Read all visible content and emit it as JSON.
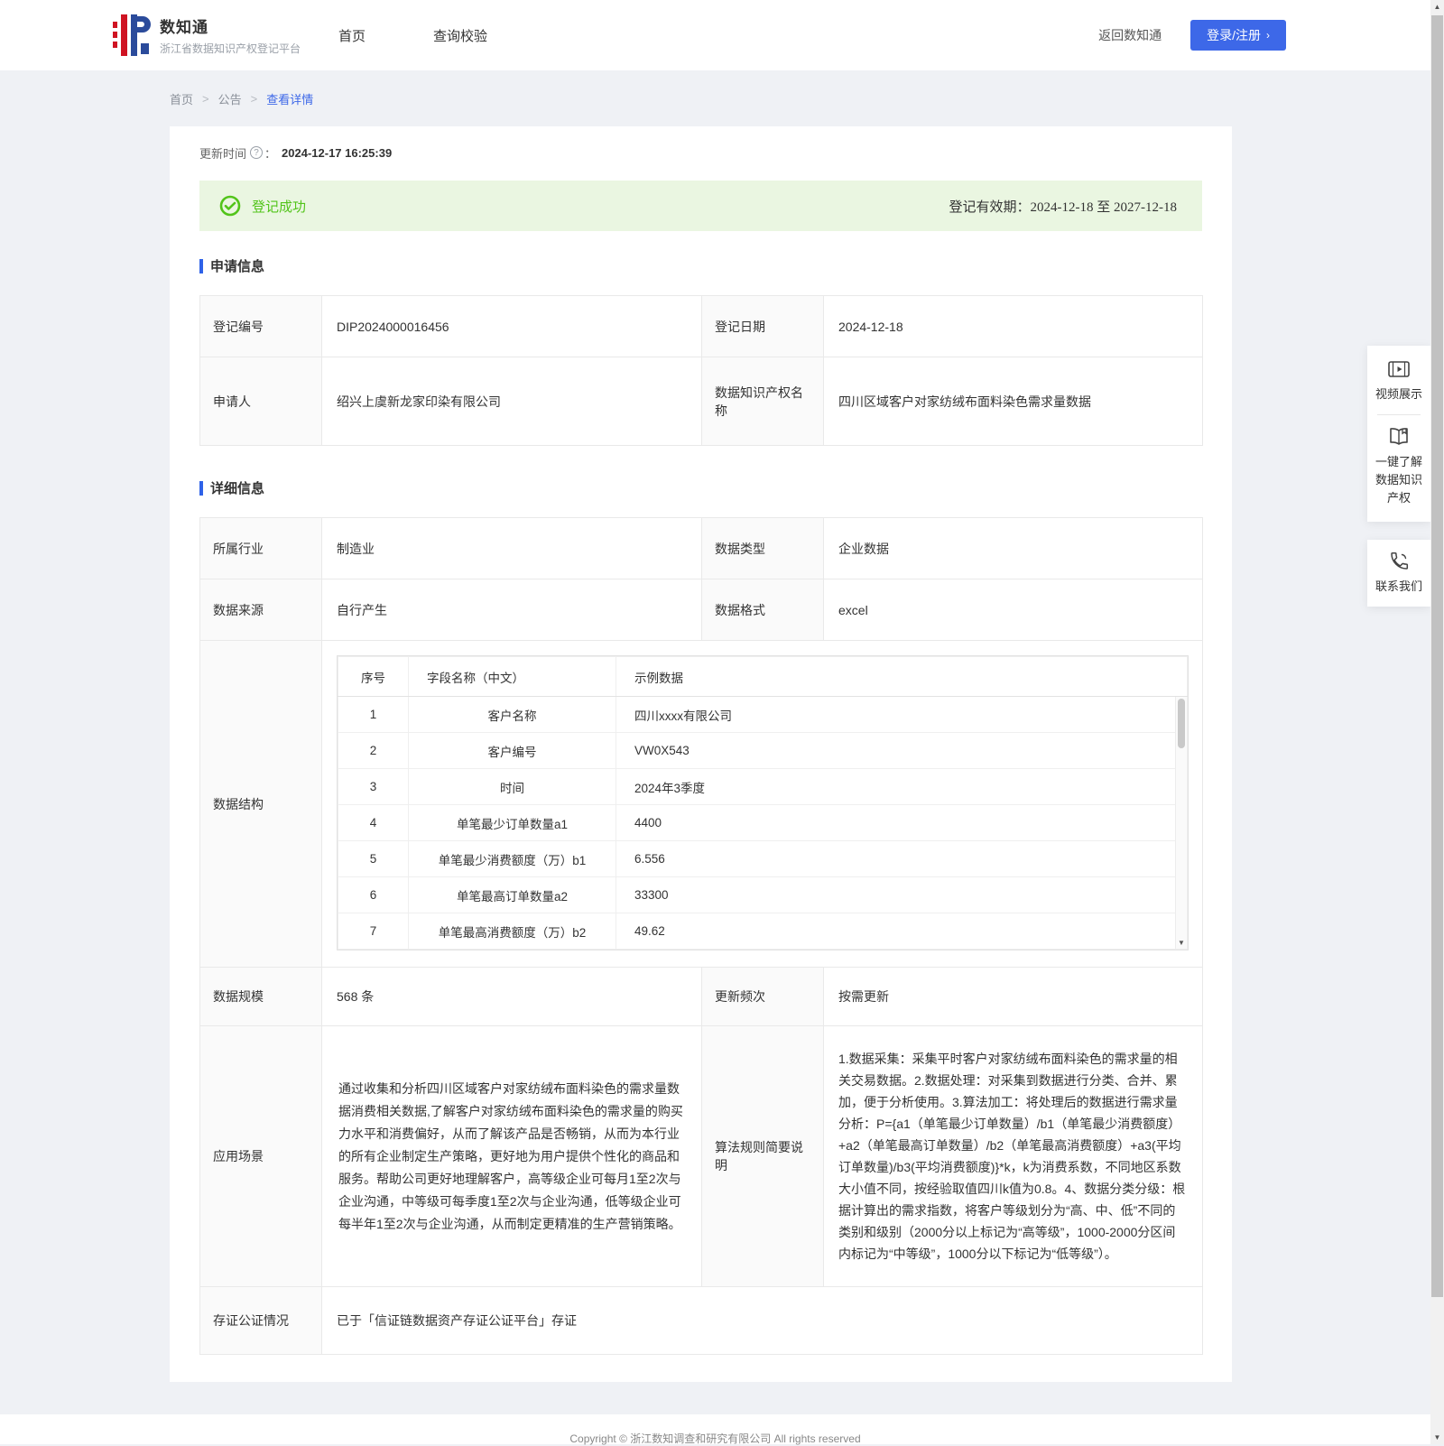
{
  "colors": {
    "accent_blue": "#3d68e8",
    "success_green": "#52c41a",
    "banner_bg": "#eaf6e1",
    "logo_red": "#cf1322",
    "logo_blue": "#2b4b9b"
  },
  "header": {
    "logo_title": "数知通",
    "logo_subtitle": "浙江省数据知识产权登记平台",
    "nav_home": "首页",
    "nav_query": "查询校验",
    "back_link": "返回数知通",
    "login_button": "登录/注册",
    "login_chevron": "›"
  },
  "breadcrumb": {
    "items": [
      "首页",
      "公告",
      "查看详情"
    ],
    "separator": ">"
  },
  "meta": {
    "update_time_label": "更新时间",
    "colon": "：",
    "update_time_value": "2024-12-17 16:25:39",
    "help_icon": "?"
  },
  "banner": {
    "status": "登记成功",
    "validity_label": "登记有效期：",
    "validity_value": "2024-12-18 至 2027-12-18"
  },
  "sections": {
    "application": "申请信息",
    "detail": "详细信息"
  },
  "application": {
    "reg_no_label": "登记编号",
    "reg_no": "DIP2024000016456",
    "reg_date_label": "登记日期",
    "reg_date": "2024-12-18",
    "applicant_label": "申请人",
    "applicant": "绍兴上虞新龙家印染有限公司",
    "ip_name_label": "数据知识产权名称",
    "ip_name": "四川区域客户对家纺绒布面料染色需求量数据"
  },
  "detail": {
    "industry_label": "所属行业",
    "industry": "制造业",
    "data_type_label": "数据类型",
    "data_type": "企业数据",
    "source_label": "数据来源",
    "source": "自行产生",
    "format_label": "数据格式",
    "format": "excel",
    "structure_label": "数据结构",
    "structure": {
      "columns": [
        "序号",
        "字段名称（中文）",
        "示例数据"
      ],
      "rows": [
        [
          "1",
          "客户名称",
          "四川xxxx有限公司"
        ],
        [
          "2",
          "客户编号",
          "VW0X543"
        ],
        [
          "3",
          "时间",
          "2024年3季度"
        ],
        [
          "4",
          "单笔最少订单数量a1",
          "4400"
        ],
        [
          "5",
          "单笔最少消费额度（万）b1",
          "6.556"
        ],
        [
          "6",
          "单笔最高订单数量a2",
          "33300"
        ],
        [
          "7",
          "单笔最高消费额度（万）b2",
          "49.62"
        ]
      ]
    },
    "scale_label": "数据规模",
    "scale": "568 条",
    "frequency_label": "更新频次",
    "frequency": "按需更新",
    "scenario_label": "应用场景",
    "scenario": "通过收集和分析四川区域客户对家纺绒布面料染色的需求量数据消费相关数据,了解客户对家纺绒布面料染色的需求量的购买力水平和消费偏好，从而了解该产品是否畅销，从而为本行业的所有企业制定生产策略，更好地为用户提供个性化的商品和服务。帮助公司更好地理解客户，高等级企业可每月1至2次与企业沟通，中等级可每季度1至2次与企业沟通，低等级企业可每半年1至2次与企业沟通，从而制定更精准的生产营销策略。",
    "algorithm_label": "算法规则简要说明",
    "algorithm": "1.数据采集：采集平时客户对家纺绒布面料染色的需求量的相关交易数据。2.数据处理：对采集到数据进行分类、合并、累加，便于分析使用。3.算法加工：将处理后的数据进行需求量分析：P={a1（单笔最少订单数量）/b1（单笔最少消费额度）+a2（单笔最高订单数量）/b2（单笔最高消费额度）+a3(平均订单数量)/b3(平均消费额度)}*k，k为消费系数，不同地区系数大小值不同，按经验取值四川k值为0.8。4、数据分类分级：根据计算出的需求指数，将客户等级划分为“高、中、低”不同的类别和级别（2000分以上标记为“高等级”，1000-2000分区间内标记为“中等级”，1000分以下标记为“低等级”）。",
    "notary_label": "存证公证情况",
    "notary": "已于「信证链数据资产存证公证平台」存证"
  },
  "float_panel": {
    "video_label": "视频展示",
    "guide_label": "一键了解数据知识产权",
    "contact_label": "联系我们"
  },
  "footer": {
    "copyright": "Copyright © 浙江数知调查和研究有限公司 All rights reserved"
  }
}
